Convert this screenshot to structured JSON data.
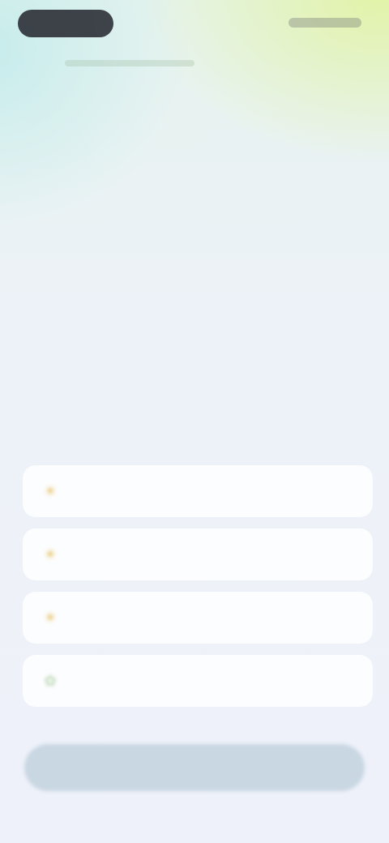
{
  "status_bar": {
    "left_pill": "",
    "right_indicators": ""
  },
  "screen": {
    "question": "",
    "options": [
      {
        "icon": "sun-icon",
        "glyph": "☀",
        "color": "#e7c46a",
        "label": ""
      },
      {
        "icon": "sun-icon",
        "glyph": "☀",
        "color": "#e7c46a",
        "label": ""
      },
      {
        "icon": "sun-icon",
        "glyph": "☀",
        "color": "#e7c46a",
        "label": ""
      },
      {
        "icon": "leaf-icon",
        "glyph": "✿",
        "color": "#bcd7b4",
        "label": ""
      }
    ],
    "continue_label": ""
  },
  "colors": {
    "accent_yellow": "#e7c46a",
    "accent_green": "#bcd7b4",
    "button_bg": "#c9d7e3"
  }
}
